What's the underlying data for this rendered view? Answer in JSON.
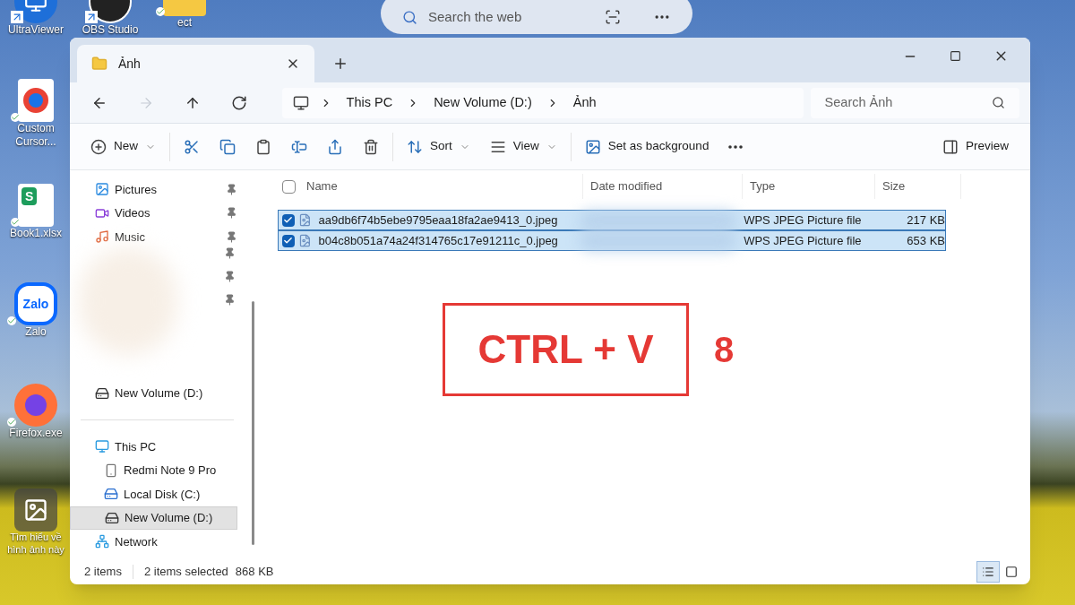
{
  "desktop": {
    "search_bar": {
      "placeholder": "Search the web"
    },
    "icons": [
      {
        "label": "UltraViewer",
        "kind": "monitor",
        "shortcut": true,
        "synced": false
      },
      {
        "label": "OBS Studio",
        "kind": "obs",
        "shortcut": true,
        "synced": false
      },
      {
        "label": "ect",
        "kind": "folder",
        "shortcut": false,
        "synced": true
      },
      {
        "label": "Custom Cursor...",
        "kind": "chrome",
        "shortcut": false,
        "synced": true
      },
      {
        "label": "Book1.xlsx",
        "kind": "sheet",
        "logo_text": "S",
        "shortcut": false,
        "synced": true
      },
      {
        "label": "Zalo",
        "kind": "zalo",
        "logo_text": "Zalo",
        "shortcut": false,
        "synced": true
      },
      {
        "label": "Firefox.exe",
        "kind": "firefox",
        "shortcut": false,
        "synced": true
      },
      {
        "label": "Tìm hiểu về hình ảnh này",
        "kind": "image",
        "shortcut": false,
        "synced": false
      }
    ]
  },
  "window": {
    "tab": {
      "title": "Ảnh"
    },
    "nav": [
      {
        "kind": "back",
        "disabled": false
      },
      {
        "kind": "forward",
        "disabled": true
      },
      {
        "kind": "up",
        "disabled": false
      },
      {
        "kind": "refresh",
        "disabled": false
      }
    ],
    "breadcrumb": [
      "This PC",
      "New Volume (D:)",
      "Ảnh"
    ],
    "search": {
      "placeholder": "Search Ảnh"
    },
    "toolbar": [
      {
        "kind": "new",
        "label": "New"
      },
      {
        "kind": "cut"
      },
      {
        "kind": "copy"
      },
      {
        "kind": "paste"
      },
      {
        "kind": "rename"
      },
      {
        "kind": "share"
      },
      {
        "kind": "delete"
      },
      {
        "kind": "sort",
        "label": "Sort"
      },
      {
        "kind": "view",
        "label": "View"
      },
      {
        "kind": "background",
        "label": "Set as background"
      },
      {
        "kind": "more"
      }
    ],
    "preview": {
      "label": "Preview"
    },
    "sidebar": {
      "quick_access": [
        {
          "label": "Pictures",
          "kind": "pictures",
          "pinned": true
        },
        {
          "label": "Videos",
          "kind": "videos",
          "pinned": true
        },
        {
          "label": "Music",
          "kind": "music",
          "pinned": true
        },
        {
          "label": "New Volume (D:)",
          "kind": "drive",
          "pinned": false
        }
      ],
      "tree": [
        {
          "label": "This PC",
          "kind": "pc",
          "selected": false,
          "children": [
            {
              "label": "Redmi Note 9 Pro",
              "kind": "phone",
              "selected": false
            },
            {
              "label": "Local Disk (C:)",
              "kind": "disk",
              "selected": false
            },
            {
              "label": "New Volume (D:)",
              "kind": "drive",
              "selected": true
            }
          ]
        },
        {
          "label": "Network",
          "kind": "network",
          "selected": false
        }
      ]
    },
    "table": {
      "select_all": {
        "checked": false
      },
      "columns": [
        "Name",
        "Date modified",
        "Type",
        "Size"
      ],
      "rows": [
        {
          "name": "aa9db6f74b5ebe9795eaa18fa2ae9413_0.jpeg",
          "type": "WPS JPEG Picture file",
          "size": "217 KB",
          "checked": true,
          "selected": true
        },
        {
          "name": "b04c8b051a74a24f314765c17e91211c_0.jpeg",
          "type": "WPS JPEG Picture file",
          "size": "653 KB",
          "checked": true,
          "selected": true
        }
      ]
    },
    "annotation": {
      "text": "CTRL + V",
      "step": "8"
    },
    "status_bar": {
      "count": "2 items",
      "selection": "2 items selected",
      "size": "868 KB",
      "views": [
        {
          "kind": "details",
          "selected": true
        },
        {
          "kind": "tiles",
          "selected": false
        }
      ]
    }
  }
}
